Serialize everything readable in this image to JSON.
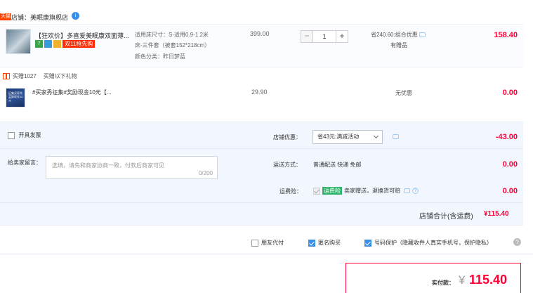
{
  "store": {
    "tag": "天猫",
    "label": "店铺：美眠康旗舰店",
    "badge": "i"
  },
  "item1": {
    "title": "【狂欢价】多喜爱美眠康双面薄...",
    "icon_7": "7",
    "icon_b": "",
    "icon_y": "",
    "tag": "双11抢先购",
    "spec1": "适用床尺寸：S-适用0.9-1.2米",
    "spec2": "床-三件套（被套152*218cm）",
    "spec3": "颜色分类：昨日梦蓝",
    "price": "399.00",
    "qty_minus": "−",
    "qty": "1",
    "qty_plus": "+",
    "promo": "省240.60:组合优惠",
    "promo_sub": "有赠品",
    "total": "158.40"
  },
  "gift": {
    "label": "买赠1027",
    "sub": "买赠以下礼物",
    "thumb_text": "征集买家秀 奖励现金10元",
    "title": "#买家秀征集#奖励现金10元【...",
    "price": "29.90",
    "promo": "无优惠",
    "total": "0.00"
  },
  "options": {
    "invoice_label": "开具发票",
    "message_label": "给卖家留言：",
    "message_placeholder": "选填，请先和商家协商一致，付款后商家可见",
    "message_count": "0/200",
    "discount_label": "店铺优惠：",
    "discount_value": "省43元:满减活动",
    "discount_total": "-43.00",
    "shipping_label": "运送方式：",
    "shipping_value": "普通配送 快递 免邮",
    "shipping_total": "0.00",
    "insurance_label": "运费险：",
    "insurance_tag": "运费险",
    "insurance_value": "卖家赠送，退换货可赔",
    "insurance_total": "0.00",
    "help": "?"
  },
  "store_total": {
    "label": "店铺合计(含运费)",
    "value": "¥115.40"
  },
  "extras": {
    "friend_pay": "朋友代付",
    "anonymous": "匿名购买",
    "number_protect": "号码保护（隐藏收件人真实手机号，保护隐私）",
    "help": "?"
  },
  "payment": {
    "label": "实付款：",
    "currency": "¥",
    "amount": "115.40"
  },
  "colors": {
    "accent_red": "#ff0036",
    "brand_orange": "#ff4400",
    "checkbox_blue": "#3a8ee6",
    "insurance_green": "#2fb36a"
  }
}
